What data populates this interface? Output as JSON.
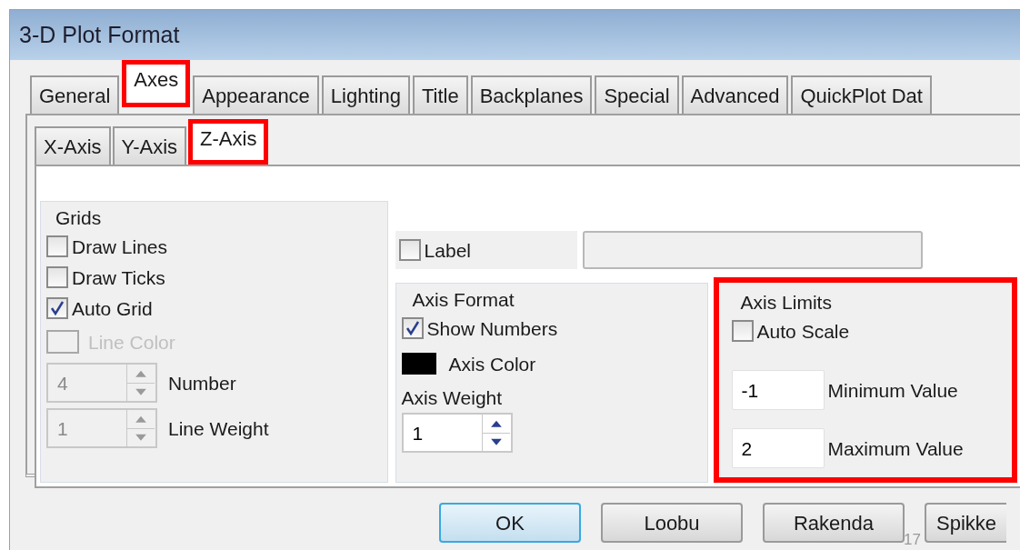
{
  "window": {
    "title": "3-D Plot Format"
  },
  "tabs": [
    {
      "label": "General",
      "selected": false,
      "highlighted": false
    },
    {
      "label": "Axes",
      "selected": true,
      "highlighted": true
    },
    {
      "label": "Appearance",
      "selected": false,
      "highlighted": false
    },
    {
      "label": "Lighting",
      "selected": false,
      "highlighted": false
    },
    {
      "label": "Title",
      "selected": false,
      "highlighted": false
    },
    {
      "label": "Backplanes",
      "selected": false,
      "highlighted": false
    },
    {
      "label": "Special",
      "selected": false,
      "highlighted": false
    },
    {
      "label": "Advanced",
      "selected": false,
      "highlighted": false
    },
    {
      "label": "QuickPlot Dat",
      "selected": false,
      "highlighted": false
    }
  ],
  "subtabs": [
    {
      "label": "X-Axis",
      "selected": false,
      "highlighted": false
    },
    {
      "label": "Y-Axis",
      "selected": false,
      "highlighted": false
    },
    {
      "label": "Z-Axis",
      "selected": true,
      "highlighted": true
    }
  ],
  "grids": {
    "title": "Grids",
    "checkboxes": [
      {
        "label": "Draw Lines",
        "checked": false
      },
      {
        "label": "Draw Ticks",
        "checked": false
      },
      {
        "label": "Auto Grid",
        "checked": true
      }
    ],
    "line_color": {
      "label": "Line Color",
      "disabled": true
    },
    "spinners": [
      {
        "value": "4",
        "label": "Number",
        "disabled": true
      },
      {
        "value": "1",
        "label": "Line Weight",
        "disabled": true
      }
    ]
  },
  "label_row": {
    "label": "Label",
    "checked": false
  },
  "axis_format": {
    "title": "Axis Format",
    "show_numbers": {
      "label": "Show Numbers",
      "checked": true
    },
    "axis_color": {
      "label": "Axis Color",
      "color": "#000000"
    },
    "weight_label": "Axis Weight",
    "weight": {
      "value": "1",
      "disabled": false
    }
  },
  "axis_limits": {
    "title": "Axis Limits",
    "highlighted": true,
    "auto_scale": {
      "label": "Auto Scale",
      "checked": false
    },
    "fields": [
      {
        "value": "-1",
        "label": "Minimum Value"
      },
      {
        "value": "2",
        "label": "Maximum Value"
      }
    ]
  },
  "buttons": [
    {
      "label": "OK",
      "default": true
    },
    {
      "label": "Loobu",
      "default": false
    },
    {
      "label": "Rakenda",
      "default": false
    },
    {
      "label": "Spikke",
      "default": false
    }
  ],
  "page_number": "17"
}
